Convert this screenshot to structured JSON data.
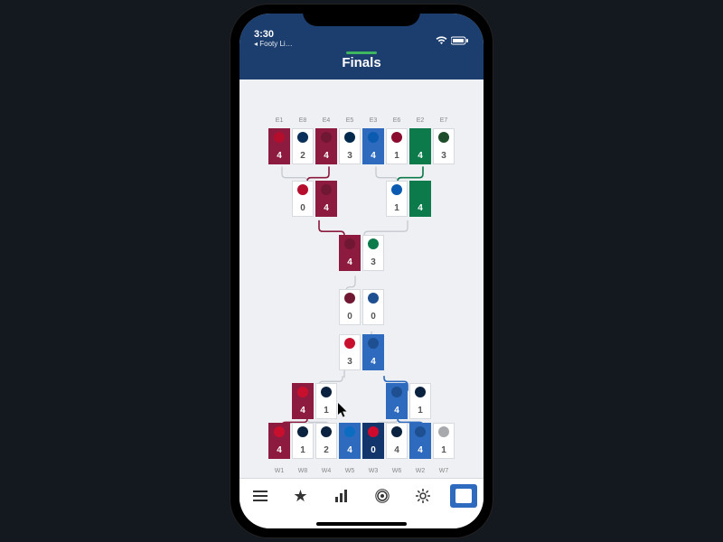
{
  "status": {
    "time": "3:30",
    "back_label": "◂  Footy Li…"
  },
  "header": {
    "title": "Finals"
  },
  "seeds": {
    "east": [
      "E1",
      "E8",
      "E4",
      "E5",
      "E3",
      "E6",
      "E2",
      "E7"
    ],
    "west": [
      "W1",
      "W8",
      "W4",
      "W5",
      "W3",
      "W6",
      "W2",
      "W7"
    ]
  },
  "colors": {
    "tor": "#b40e2c",
    "was": "#0a2f5a",
    "cle": "#6f1733",
    "ind": "#032a4c",
    "phi": "#0b5bb0",
    "mia": "#8a0b2e",
    "bos": "#0c7a4b",
    "mil": "#1e4d2b",
    "gsw": "#1d4f91",
    "hou": "#c8102e",
    "uta": "#0a2240",
    "min": "#0c2340",
    "okc": "#0b6cc0",
    "por": "#cf0a2c",
    "nop": "#0a2240",
    "sas": "#a7a9ac"
  },
  "rounds": {
    "east_r1": [
      {
        "t": "tor",
        "s": 4,
        "w": "red"
      },
      {
        "t": "was",
        "s": 2,
        "w": ""
      },
      {
        "t": "cle",
        "s": 4,
        "w": "red"
      },
      {
        "t": "ind",
        "s": 3,
        "w": ""
      },
      {
        "t": "phi",
        "s": 4,
        "w": "blue"
      },
      {
        "t": "mia",
        "s": 1,
        "w": ""
      },
      {
        "t": "bos",
        "s": 4,
        "w": "green"
      },
      {
        "t": "mil",
        "s": 3,
        "w": ""
      }
    ],
    "east_r2": [
      {
        "t": "tor",
        "s": 0,
        "w": ""
      },
      {
        "t": "cle",
        "s": 4,
        "w": "red"
      },
      {
        "t": "phi",
        "s": 1,
        "w": ""
      },
      {
        "t": "bos",
        "s": 4,
        "w": "green"
      }
    ],
    "east_cf": [
      {
        "t": "cle",
        "s": 4,
        "w": "red"
      },
      {
        "t": "bos",
        "s": 3,
        "w": ""
      }
    ],
    "finals": [
      {
        "t": "cle",
        "s": 0,
        "w": ""
      },
      {
        "t": "gsw",
        "s": 0,
        "w": ""
      }
    ],
    "west_cf": [
      {
        "t": "hou",
        "s": 3,
        "w": ""
      },
      {
        "t": "gsw",
        "s": 4,
        "w": "blue"
      }
    ],
    "west_r2": [
      {
        "t": "hou",
        "s": 4,
        "w": "red"
      },
      {
        "t": "uta",
        "s": 1,
        "w": ""
      },
      {
        "t": "gsw",
        "s": 4,
        "w": "blue"
      },
      {
        "t": "nop",
        "s": 1,
        "w": ""
      }
    ],
    "west_r1": [
      {
        "t": "hou",
        "s": 4,
        "w": "red"
      },
      {
        "t": "min",
        "s": 1,
        "w": ""
      },
      {
        "t": "uta",
        "s": 2,
        "w": ""
      },
      {
        "t": "okc",
        "s": 4,
        "w": "blue"
      },
      {
        "t": "por",
        "s": 0,
        "w": "navy"
      },
      {
        "t": "nop",
        "s": 4,
        "w": ""
      },
      {
        "t": "gsw",
        "s": 4,
        "w": "blue"
      },
      {
        "t": "sas",
        "s": 1,
        "w": ""
      }
    ]
  },
  "tabs": [
    {
      "name": "menu-icon",
      "glyph": "≡"
    },
    {
      "name": "star-icon",
      "glyph": "★"
    },
    {
      "name": "chart-icon",
      "glyph": "⎍"
    },
    {
      "name": "podcast-icon",
      "glyph": "◎"
    },
    {
      "name": "gear-icon",
      "glyph": "✿"
    },
    {
      "name": "bracket-icon",
      "glyph": "★"
    }
  ],
  "active_tab": 5
}
